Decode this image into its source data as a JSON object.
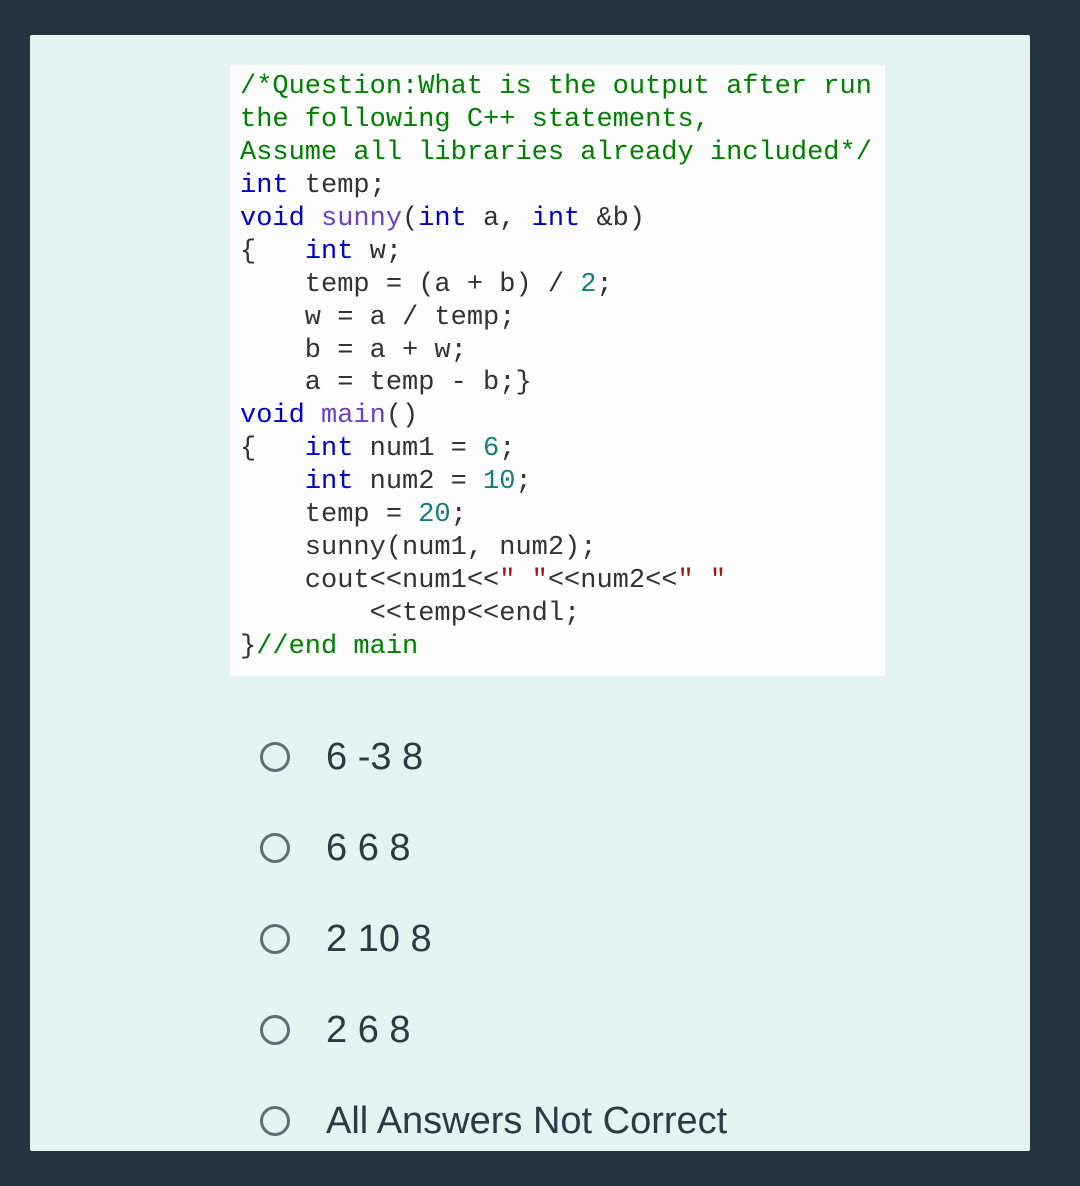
{
  "code": {
    "comment_l1": "/*Question:What is the output after run",
    "comment_l2": "the following C++ statements,",
    "comment_l3": "Assume all libraries already included*/",
    "l4_int": "int",
    "l4_rest": " temp;",
    "l5_void": "void",
    "l5_fn": " sunny",
    "l5_p1": "(",
    "l5_int1": "int",
    "l5_a": " a, ",
    "l5_int2": "int",
    "l5_b": " &b)",
    "l6_brace": "{   ",
    "l6_int": "int",
    "l6_w": " w;",
    "l7": "    temp = (a + b) / ",
    "l7_n": "2",
    "l7_s": ";",
    "l8": "    w = a / temp;",
    "l9": "    b = a + w;",
    "l10": "    a = temp - b;}",
    "l11_void": "void",
    "l11_fn": " main",
    "l11_p": "()",
    "l12_brace": "{   ",
    "l12_int": "int",
    "l12_a": " num1 = ",
    "l12_n": "6",
    "l12_s": ";",
    "l13_pad": "    ",
    "l13_int": "int",
    "l13_a": " num2 = ",
    "l13_n": "10",
    "l13_s": ";",
    "l14_a": "    temp = ",
    "l14_n": "20",
    "l14_s": ";",
    "l15": "    sunny(num1, num2);",
    "l16_a": "    cout<<num1<<",
    "l16_str1": "\" \"",
    "l16_b": "<<num2<<",
    "l16_str2": "\" \"",
    "l17": "        <<temp<<endl;",
    "l18_brace": "}",
    "l18_cm": "//end main"
  },
  "options": [
    {
      "label": "6 -3 8"
    },
    {
      "label": "6 6 8"
    },
    {
      "label": "2 10 8"
    },
    {
      "label": "2 6 8"
    },
    {
      "label": "All Answers Not Correct"
    }
  ]
}
